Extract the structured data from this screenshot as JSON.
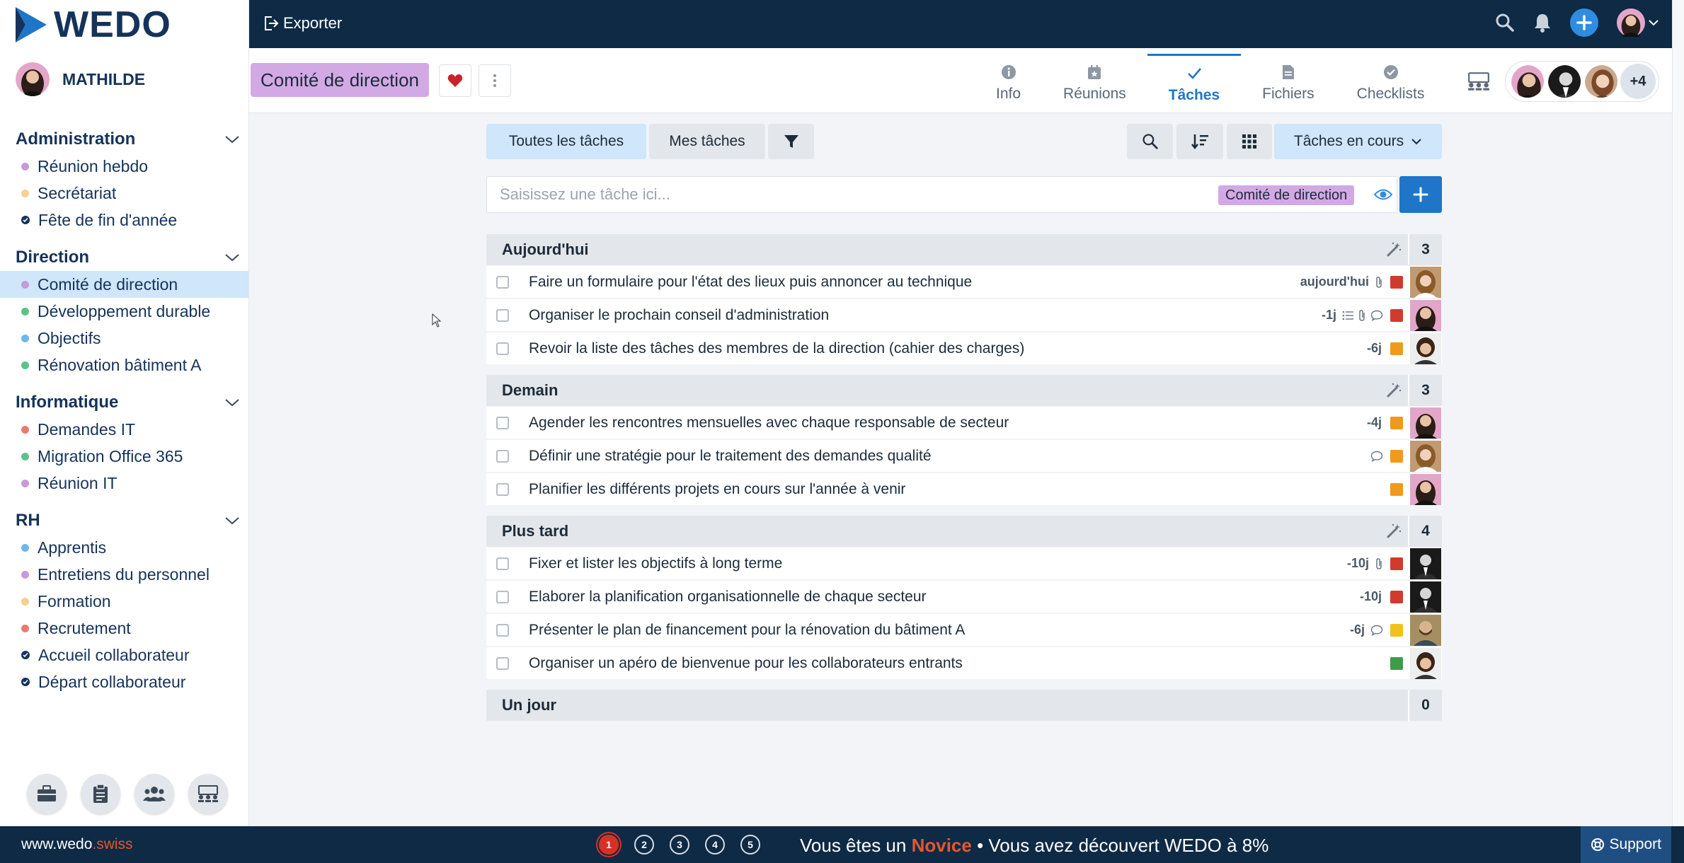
{
  "app": {
    "brand": "WEDO",
    "user": "MATHILDE"
  },
  "topbar": {
    "export_label": "Exporter"
  },
  "sidebar": {
    "groups": [
      {
        "title": "Administration",
        "items": [
          {
            "label": "Réunion hebdo",
            "dot": "#c79ad8",
            "type": "dot"
          },
          {
            "label": "Secrétariat",
            "dot": "#f6d08d",
            "type": "dot"
          },
          {
            "label": "Fête de fin d'année",
            "dot": "#15335a",
            "type": "check"
          }
        ]
      },
      {
        "title": "Direction",
        "items": [
          {
            "label": "Comité de direction",
            "dot": "#c79ad8",
            "type": "dot",
            "active": true
          },
          {
            "label": "Développement durable",
            "dot": "#5cc28a",
            "type": "dot"
          },
          {
            "label": "Objectifs",
            "dot": "#6fb7ea",
            "type": "dot"
          },
          {
            "label": "Rénovation bâtiment A",
            "dot": "#5cc28a",
            "type": "dot"
          }
        ]
      },
      {
        "title": "Informatique",
        "items": [
          {
            "label": "Demandes IT",
            "dot": "#e97a6f",
            "type": "dot"
          },
          {
            "label": "Migration Office 365",
            "dot": "#5cc28a",
            "type": "dot"
          },
          {
            "label": "Réunion IT",
            "dot": "#c79ad8",
            "type": "dot"
          }
        ]
      },
      {
        "title": "RH",
        "items": [
          {
            "label": "Apprentis",
            "dot": "#6fb7ea",
            "type": "dot"
          },
          {
            "label": "Entretiens du personnel",
            "dot": "#c79ad8",
            "type": "dot"
          },
          {
            "label": "Formation",
            "dot": "#f6d08d",
            "type": "dot"
          },
          {
            "label": "Recrutement",
            "dot": "#e97a6f",
            "type": "dot"
          },
          {
            "label": "Accueil collaborateur",
            "dot": "#15335a",
            "type": "check"
          },
          {
            "label": "Départ collaborateur",
            "dot": "#15335a",
            "type": "check"
          }
        ]
      }
    ]
  },
  "project": {
    "title": "Comité de direction"
  },
  "tabs": [
    {
      "label": "Info",
      "icon": "info-icon"
    },
    {
      "label": "Réunions",
      "icon": "calendar-icon"
    },
    {
      "label": "Tâches",
      "icon": "check-icon",
      "active": true
    },
    {
      "label": "Fichiers",
      "icon": "file-icon"
    },
    {
      "label": "Checklists",
      "icon": "checklist-icon"
    }
  ],
  "members": {
    "extra": "+4"
  },
  "toolbar": {
    "all_tasks": "Toutes les tâches",
    "my_tasks": "Mes tâches",
    "status_filter": "Tâches en cours"
  },
  "task_input": {
    "placeholder": "Saisissez une tâche ici...",
    "tag": "Comité de direction"
  },
  "sections": [
    {
      "title": "Aujourd'hui",
      "count": "3",
      "tasks": [
        {
          "title": "Faire un formulaire pour l'état des lieux puis annoncer au technique",
          "due": "aujourd'hui",
          "icons": [
            "attach"
          ],
          "prio": "#d13b2e"
        },
        {
          "title": "Organiser le prochain conseil d'administration",
          "due": "-1j",
          "icons": [
            "list",
            "attach",
            "comment"
          ],
          "prio": "#d13b2e"
        },
        {
          "title": "Revoir la liste des tâches des membres de la direction (cahier des charges)",
          "due": "-6j",
          "icons": [],
          "prio": "#ef9a1b"
        }
      ]
    },
    {
      "title": "Demain",
      "count": "3",
      "tasks": [
        {
          "title": "Agender les rencontres mensuelles avec chaque responsable de secteur",
          "due": "-4j",
          "icons": [],
          "prio": "#ef9a1b"
        },
        {
          "title": "Définir une stratégie pour le traitement des demandes qualité",
          "due": "",
          "icons": [
            "comment"
          ],
          "prio": "#ef9a1b"
        },
        {
          "title": "Planifier les différents projets en cours sur l'année à venir",
          "due": "",
          "icons": [],
          "prio": "#ef9a1b"
        }
      ]
    },
    {
      "title": "Plus tard",
      "count": "4",
      "tasks": [
        {
          "title": "Fixer et lister les objectifs à long terme",
          "due": "-10j",
          "icons": [
            "attach"
          ],
          "prio": "#d13b2e"
        },
        {
          "title": "Elaborer la planification organisationnelle de chaque secteur",
          "due": "-10j",
          "icons": [],
          "prio": "#d13b2e"
        },
        {
          "title": "Présenter le plan de financement pour la rénovation du bâtiment A",
          "due": "-6j",
          "icons": [
            "comment"
          ],
          "prio": "#f1c21b"
        },
        {
          "title": "Organiser un apéro de bienvenue pour les collaborateurs entrants",
          "due": "",
          "icons": [],
          "prio": "#3e9c4b"
        }
      ]
    },
    {
      "title": "Un jour",
      "count": "0",
      "tasks": []
    }
  ],
  "footer": {
    "site_prefix": "www.wedo",
    "site_suffix": ".swiss",
    "steps": [
      "1",
      "2",
      "3",
      "4",
      "5"
    ],
    "level_prefix": "Vous êtes un",
    "level_name": "Novice",
    "level_suffix": "• Vous avez découvert WEDO à 8%",
    "support": "Support"
  }
}
